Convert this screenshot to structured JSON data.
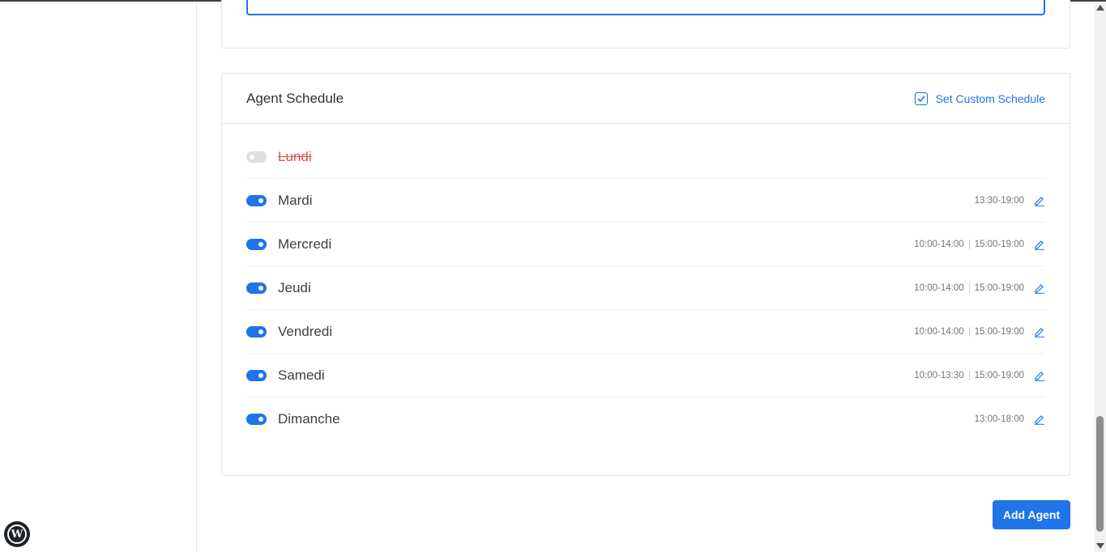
{
  "schedule": {
    "title": "Agent Schedule",
    "custom_schedule_label": "Set Custom Schedule",
    "days": [
      {
        "name": "Lundi",
        "enabled": false,
        "times": []
      },
      {
        "name": "Mardi",
        "enabled": true,
        "times": [
          "13:30-19:00"
        ]
      },
      {
        "name": "Mercredi",
        "enabled": true,
        "times": [
          "10:00-14:00",
          "15:00-19:00"
        ]
      },
      {
        "name": "Jeudi",
        "enabled": true,
        "times": [
          "10:00-14:00",
          "15:00-19:00"
        ]
      },
      {
        "name": "Vendredi",
        "enabled": true,
        "times": [
          "10:00-14:00",
          "15:00-19:00"
        ]
      },
      {
        "name": "Samedi",
        "enabled": true,
        "times": [
          "10:00-13:30",
          "15:00-19:00"
        ]
      },
      {
        "name": "Dimanche",
        "enabled": true,
        "times": [
          "13:00-18:00"
        ]
      }
    ]
  },
  "actions": {
    "add_agent_label": "Add Agent"
  },
  "colors": {
    "accent": "#1f74e8",
    "disabled_day": "#d9534f"
  },
  "icons": {
    "edit": "pencil-icon",
    "checkbox": "checkbox-checked-icon",
    "logo": "wordpress-logo-icon"
  }
}
